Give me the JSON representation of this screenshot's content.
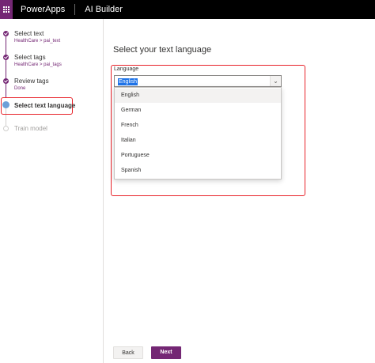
{
  "header": {
    "app_name": "PowerApps",
    "product_name": "AI Builder",
    "waffle_icon": "waffle-icon",
    "accent_color": "#742774"
  },
  "steps": [
    {
      "title": "Select text",
      "subtitle": "HealthCare > pai_text",
      "state": "done"
    },
    {
      "title": "Select tags",
      "subtitle": "HealthCare > pai_tags",
      "state": "done"
    },
    {
      "title": "Review tags",
      "subtitle": "Done",
      "state": "done"
    },
    {
      "title": "Select text language",
      "subtitle": "",
      "state": "current"
    },
    {
      "title": "Train model",
      "subtitle": "",
      "state": "pending"
    }
  ],
  "main": {
    "title": "Select your text language",
    "language_label": "Language",
    "selected_language": "English",
    "options": [
      "English",
      "German",
      "French",
      "Italian",
      "Portuguese",
      "Spanish"
    ]
  },
  "footer": {
    "back_label": "Back",
    "next_label": "Next"
  }
}
